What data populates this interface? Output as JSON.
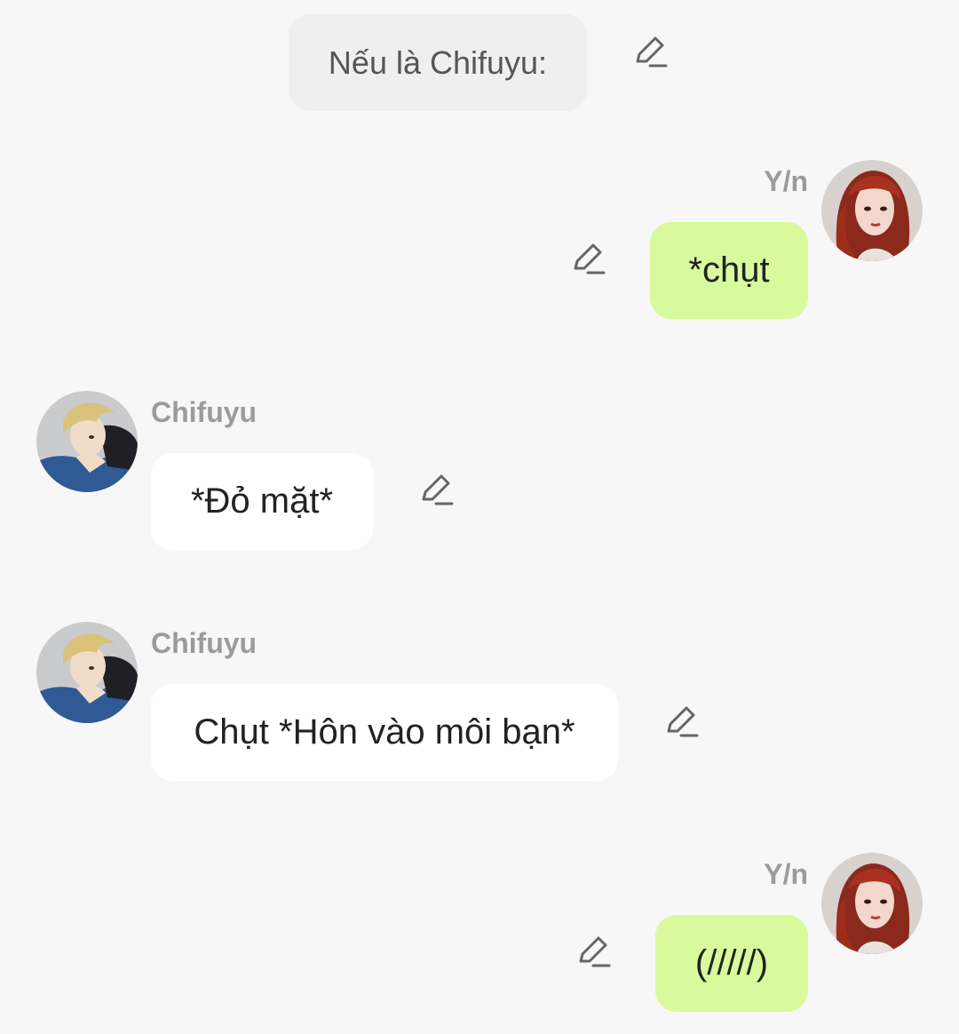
{
  "narration": {
    "text": "Nếu là Chifuyu:"
  },
  "messages": [
    {
      "sender": "Y/n",
      "side": "right",
      "text": "*chụt"
    },
    {
      "sender": "Chifuyu",
      "side": "left",
      "text": "*Đỏ mặt*"
    },
    {
      "sender": "Chifuyu",
      "side": "left",
      "text": "Chụt *Hôn vào môi bạn*"
    },
    {
      "sender": "Y/n",
      "side": "right",
      "text": "(/////)"
    }
  ],
  "colors": {
    "background": "#f7f7f7",
    "narration_bubble": "#efefef",
    "my_bubble": "#d9f99d",
    "their_bubble": "#ffffff",
    "name_text": "#9b9b9b",
    "icon": "#666666"
  },
  "icons": {
    "edit": "pencil-edit-icon",
    "avatar_yn": "avatar-red-hair-girl",
    "avatar_chifuyu": "avatar-blond-boy"
  }
}
